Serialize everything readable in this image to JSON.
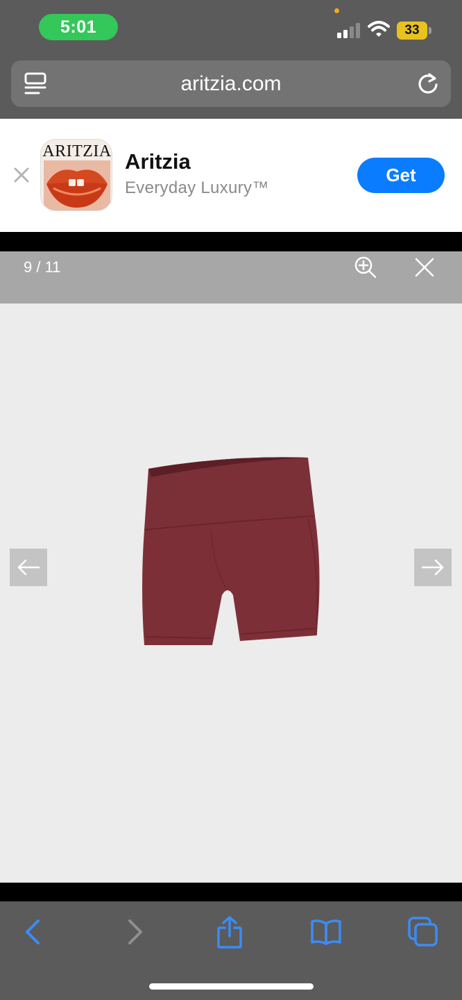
{
  "status_bar": {
    "time": "5:01",
    "battery": "33",
    "colors": {
      "time_pill": "#34c759",
      "battery": "#e8c21f",
      "privacy_dot": "#f5a623"
    }
  },
  "address_bar": {
    "domain": "aritzia.com",
    "left_icon": "reader-icon",
    "right_icon": "reload-icon"
  },
  "app_banner": {
    "icon_wordmark": "ARITZIA",
    "name": "Aritzia",
    "tagline": "Everyday Luxury™",
    "get_label": "Get",
    "accent": "#0a7cff"
  },
  "gallery": {
    "counter": "9 / 11",
    "zoom_icon": "zoom-in-icon",
    "close_icon": "close-icon",
    "prev_icon": "arrow-left-icon",
    "next_icon": "arrow-right-icon",
    "product_color": "#7b3038"
  },
  "toolbar": {
    "items": [
      "back",
      "forward",
      "share",
      "bookmarks",
      "tabs"
    ],
    "accent": "#3b8cf5",
    "disabled": "#8f8f8f"
  }
}
